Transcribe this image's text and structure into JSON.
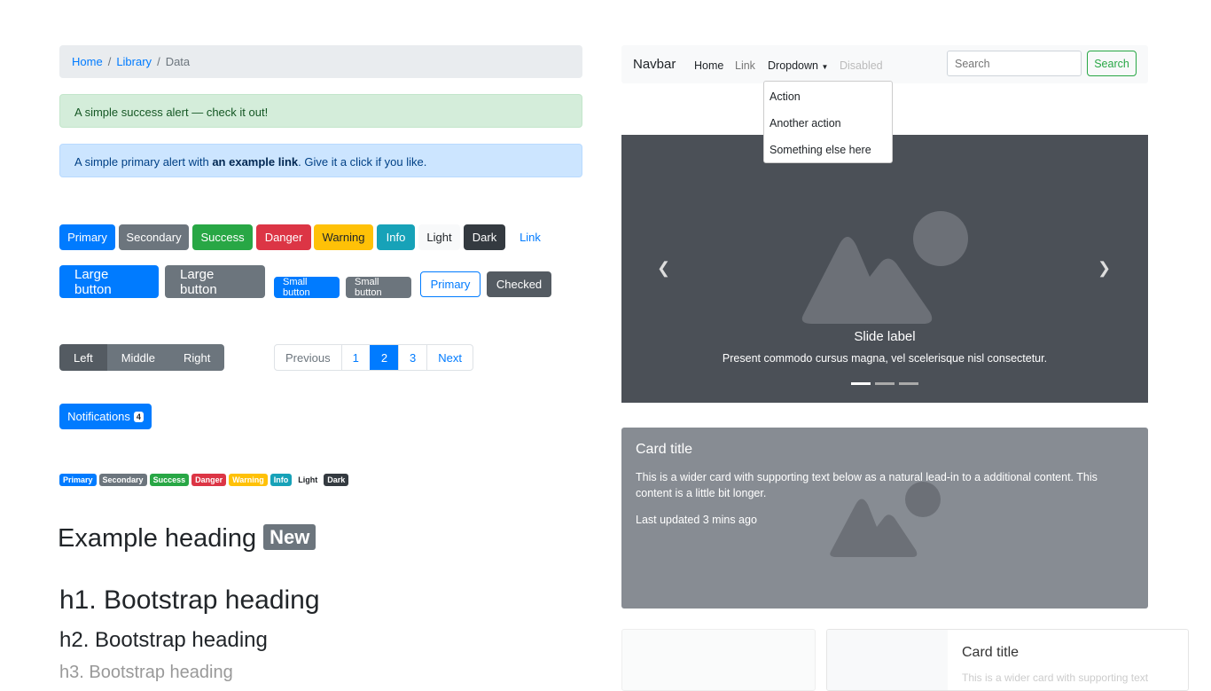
{
  "breadcrumb": {
    "items": [
      "Home",
      "Library"
    ],
    "active": "Data"
  },
  "alerts": {
    "success": "A simple success alert — check it out!",
    "primary_pre": "A simple primary alert with ",
    "primary_link": "an example link",
    "primary_post": ". Give it a click if you like."
  },
  "buttons": {
    "row1": [
      "Primary",
      "Secondary",
      "Success",
      "Danger",
      "Warning",
      "Info",
      "Light",
      "Dark",
      "Link"
    ],
    "large": "Large button",
    "small": "Small button",
    "outline": "Primary",
    "checked": "Checked"
  },
  "button_group": [
    "Left",
    "Middle",
    "Right"
  ],
  "pagination": [
    "Previous",
    "1",
    "2",
    "3",
    "Next"
  ],
  "pagination_active": "2",
  "notifications": {
    "label": "Notifications",
    "count": "4"
  },
  "badges": [
    "Primary",
    "Secondary",
    "Success",
    "Danger",
    "Warning",
    "Info",
    "Light",
    "Dark"
  ],
  "headings": {
    "example": "Example heading",
    "new_badge": "New",
    "h1": "h1. Bootstrap heading",
    "h2": "h2. Bootstrap heading",
    "h3": "h3. Bootstrap heading"
  },
  "navbar": {
    "brand": "Navbar",
    "home": "Home",
    "link": "Link",
    "dropdown": "Dropdown",
    "disabled": "Disabled",
    "search_placeholder": "Search",
    "search_button": "Search",
    "menu": [
      "Action",
      "Another action",
      "Something else here"
    ]
  },
  "carousel": {
    "label": "Slide label",
    "caption": "Present commodo cursus magna, vel scelerisque nisl consectetur.",
    "slides": 3,
    "active": 1
  },
  "card": {
    "title": "Card title",
    "text": "This is a wider card with supporting text below as a natural lead-in to a additional content. This content is a little bit longer.",
    "updated": "Last updated 3 mins ago"
  },
  "card2": {
    "title": "Card title",
    "text": "This is a wider card with supporting text"
  },
  "colors": {
    "primary": "#007bff",
    "secondary": "#6c757d",
    "success": "#28a745",
    "danger": "#dc3545",
    "warning": "#ffc107",
    "info": "#17a2b8",
    "dark": "#343a40"
  }
}
